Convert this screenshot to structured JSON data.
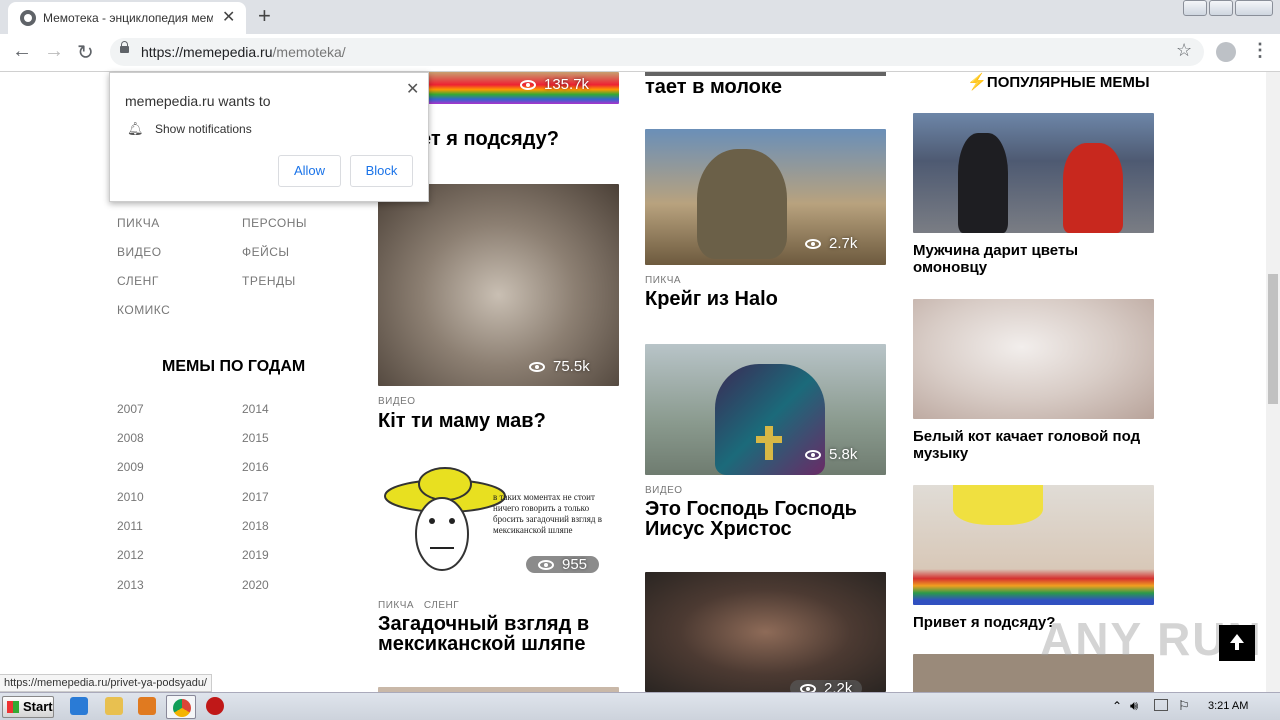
{
  "browser": {
    "tab_title": "Мемотека - энциклопедия мемов",
    "url_host": "https://memepedia.ru",
    "url_path": "/memoteka/",
    "status_url": "https://memepedia.ru/privet-ya-podsyadu/"
  },
  "notification": {
    "title": "memepedia.ru wants to",
    "message": "Show notifications",
    "allow": "Allow",
    "block": "Block"
  },
  "sidebar": {
    "nav_left": [
      "ПИКЧА",
      "ВИДЕО",
      "СЛЕНГ",
      "КОМИКС"
    ],
    "nav_right": [
      "ПЕРСОНЫ",
      "ФЕЙСЫ",
      "ТРЕНДЫ"
    ],
    "years_heading": "МЕМЫ ПО ГОДАМ",
    "years_left": [
      "2007",
      "2008",
      "2009",
      "2010",
      "2011",
      "2012",
      "2013"
    ],
    "years_right": [
      "2014",
      "2015",
      "2016",
      "2017",
      "2018",
      "2019",
      "2020"
    ]
  },
  "col1": {
    "top_views": "135.7k",
    "top_title_partial": "ет я подсяду?",
    "cards": [
      {
        "views": "75.5k",
        "category": "ВИДЕО",
        "title": "Кіт ти маму мав?"
      },
      {
        "views": "955",
        "category": "ПИКЧА   СЛЕНГ",
        "title": "Загадочный взгляд в мексиканской шляпе",
        "image_text": "в таких моментах не стоит ничего говорить а только бросить загадочний взгляд в мексиканской шляпе"
      }
    ]
  },
  "col2": {
    "top_title_partial": "тает в молоке",
    "cards": [
      {
        "views": "2.7k",
        "category": "ПИКЧА",
        "title": "Крейг из Halo"
      },
      {
        "views": "5.8k",
        "category": "ВИДЕО",
        "title": "Это Господь Господь Иисус Христос"
      },
      {
        "views": "2.2k"
      }
    ]
  },
  "popular": {
    "heading": "ПОПУЛЯРНЫЕ МЕМЫ",
    "items": [
      {
        "title": "Мужчина дарит цветы омоновцу"
      },
      {
        "title": "Белый кот качает головой под музыку"
      },
      {
        "title": "Привет я подсяду?"
      }
    ]
  },
  "watermark": "ANY RUN",
  "taskbar": {
    "start": "Start",
    "clock": "3:21 AM"
  }
}
